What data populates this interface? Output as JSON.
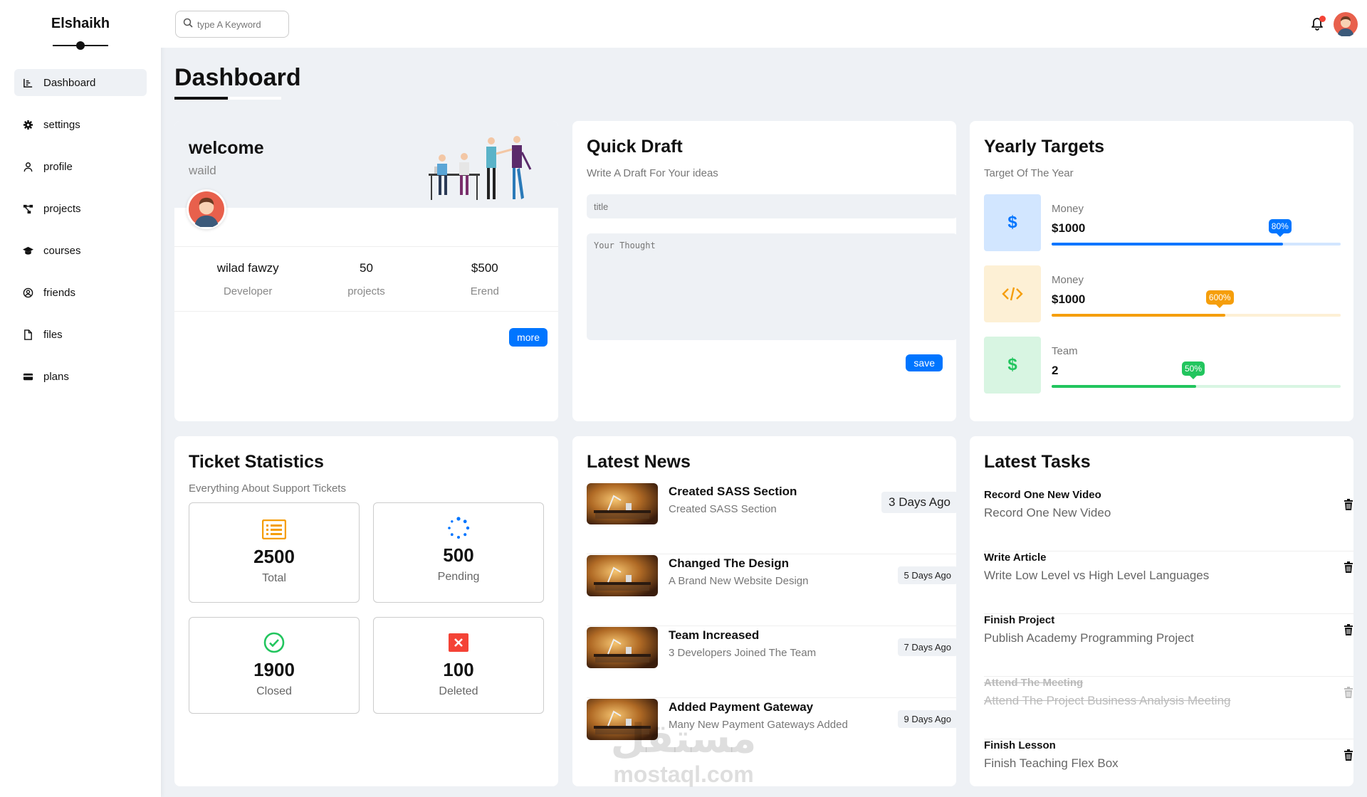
{
  "brand": "Elshaikh",
  "sidebar": {
    "items": [
      {
        "label": "Dashboard",
        "icon": "chart-icon",
        "active": true
      },
      {
        "label": "settings",
        "icon": "gear-icon"
      },
      {
        "label": "profile",
        "icon": "user-icon"
      },
      {
        "label": "projects",
        "icon": "diagram-icon"
      },
      {
        "label": "courses",
        "icon": "graduation-cap-icon"
      },
      {
        "label": "friends",
        "icon": "user-circle-icon"
      },
      {
        "label": "files",
        "icon": "file-icon"
      },
      {
        "label": "plans",
        "icon": "credit-card-icon"
      }
    ]
  },
  "header": {
    "search_placeholder": "type A Keyword"
  },
  "page_title": "Dashboard",
  "welcome": {
    "title": "welcome",
    "name": "waild",
    "stats": [
      {
        "value": "wilad fawzy",
        "label": "Developer"
      },
      {
        "value": "50",
        "label": "projects"
      },
      {
        "value": "$500",
        "label": "Erend"
      }
    ],
    "more_label": "more"
  },
  "draft": {
    "title": "Quick Draft",
    "subtitle": "Write A Draft For Your ideas",
    "title_placeholder": "title",
    "body_placeholder": "Your Thought",
    "save_label": "save"
  },
  "targets": {
    "title": "Yearly Targets",
    "subtitle": "Target Of The Year",
    "items": [
      {
        "label": "Money",
        "value": "$1000",
        "badge": "80%",
        "progress": 0.8,
        "icon": "dollar-icon",
        "color": "#0075ff",
        "bg": "#d2e6ff"
      },
      {
        "label": "Money",
        "value": "$1000",
        "badge": "600%",
        "progress": 0.6,
        "icon": "code-icon",
        "color": "#f59e0b",
        "bg": "#fdf0d5"
      },
      {
        "label": "Team",
        "value": "2",
        "badge": "50%",
        "progress": 0.5,
        "icon": "dollar-icon",
        "color": "#22c55e",
        "bg": "#d8f5e2"
      }
    ]
  },
  "tickets": {
    "title": "Ticket Statistics",
    "subtitle": "Everything About Support Tickets",
    "items": [
      {
        "value": "2500",
        "label": "Total",
        "icon": "list-icon",
        "color": "#f59e0b"
      },
      {
        "value": "500",
        "label": "Pending",
        "icon": "spinner-icon",
        "color": "#0075ff"
      },
      {
        "value": "1900",
        "label": "Closed",
        "icon": "check-circle-icon",
        "color": "#22c55e"
      },
      {
        "value": "100",
        "label": "Deleted",
        "icon": "close-box-icon",
        "color": "#f44336"
      }
    ]
  },
  "news": {
    "title": "Latest News",
    "items": [
      {
        "title": "Created SASS Section",
        "desc": "Created SASS Section",
        "date": "3 Days Ago"
      },
      {
        "title": "Changed The Design",
        "desc": "A Brand New Website Design",
        "date": "5 Days Ago"
      },
      {
        "title": "Team Increased",
        "desc": "3 Developers Joined The Team",
        "date": "7 Days Ago"
      },
      {
        "title": "Added Payment Gateway",
        "desc": "Many New Payment Gateways Added",
        "date": "9 Days Ago"
      }
    ]
  },
  "tasks": {
    "title": "Latest Tasks",
    "items": [
      {
        "title": "Record One New Video",
        "desc": "Record One New Video",
        "done": false
      },
      {
        "title": "Write Article",
        "desc": "Write Low Level vs High Level Languages",
        "done": false
      },
      {
        "title": "Finish Project",
        "desc": "Publish Academy Programming Project",
        "done": false
      },
      {
        "title": "Attend The Meeting",
        "desc": "Attend The Project Business Analysis Meeting",
        "done": true
      },
      {
        "title": "Finish Lesson",
        "desc": "Finish Teaching Flex Box",
        "done": false
      }
    ]
  },
  "watermark": {
    "arabic": "مستقل",
    "latin": "mostaql.com"
  }
}
